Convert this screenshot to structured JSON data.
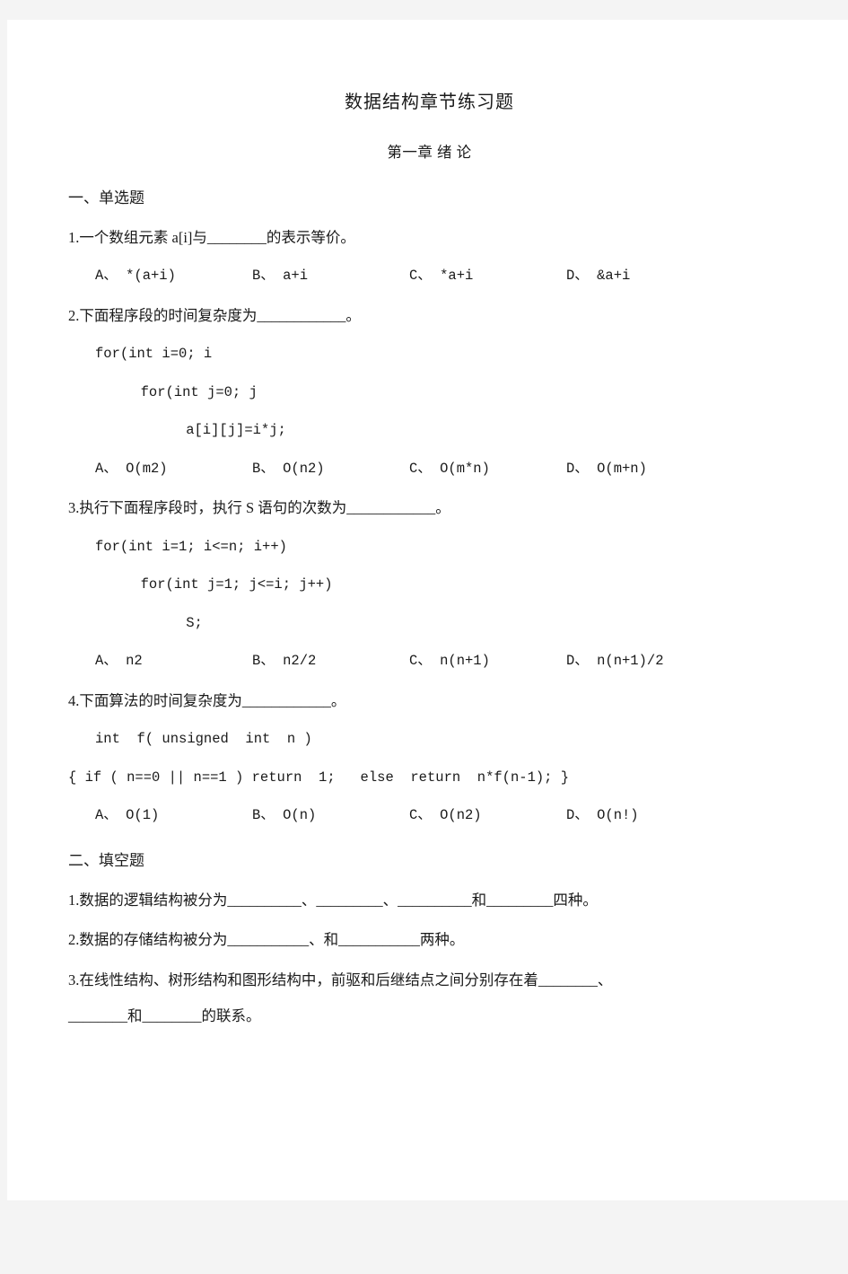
{
  "document": {
    "title": "数据结构章节练习题",
    "chapter": "第一章 绪 论"
  },
  "sections": [
    {
      "heading": "一、单选题"
    },
    {
      "heading": "二、填空题"
    }
  ],
  "multiple_choice": {
    "heading": "一、单选题",
    "questions": [
      {
        "number": "1.",
        "stem": "1.一个数组元素 a[i]与________的表示等价。",
        "code": [],
        "options": [
          "A、 *(a+i)",
          "B、 a+i",
          "C、 *a+i",
          "D、 &a+i"
        ]
      },
      {
        "number": "2.",
        "stem": "2.下面程序段的时间复杂度为____________。",
        "code": [
          "for(int i=0; i",
          "  for(int j=0; j",
          "    a[i][j]=i*j;"
        ],
        "options": [
          "A、 O(m2)",
          "B、 O(n2)",
          "C、 O(m*n)",
          "D、 O(m+n)"
        ]
      },
      {
        "number": "3.",
        "stem": "3.执行下面程序段时，执行 S 语句的次数为____________。",
        "code": [
          "for(int i=1; i<=n; i++)",
          "  for(int j=1; j<=i; j++)",
          "    S;"
        ],
        "options": [
          "A、 n2",
          "B、 n2/2",
          "C、 n(n+1)",
          "D、 n(n+1)/2"
        ]
      },
      {
        "number": "4.",
        "stem": "4.下面算法的时间复杂度为____________。",
        "code": [
          "int  f( unsigned  int  n )",
          "{ if ( n==0 || n==1 ) return  1;   else  return  n*f(n-1); }"
        ],
        "options": [
          "A、 O(1)",
          "B、 O(n)",
          "C、 O(n2)",
          "D、 O(n!)"
        ]
      }
    ]
  },
  "fill_in_blank": {
    "heading": "二、填空题",
    "questions": [
      {
        "number": "1.",
        "text": "1.数据的逻辑结构被分为__________、_________、__________和_________四种。",
        "continuation": ""
      },
      {
        "number": "2.",
        "text": "2.数据的存储结构被分为___________、和___________两种。",
        "continuation": ""
      },
      {
        "number": "3.",
        "text": "3.在线性结构、树形结构和图形结构中，前驱和后继结点之间分别存在着________、",
        "continuation": "________和________的联系。"
      }
    ]
  }
}
